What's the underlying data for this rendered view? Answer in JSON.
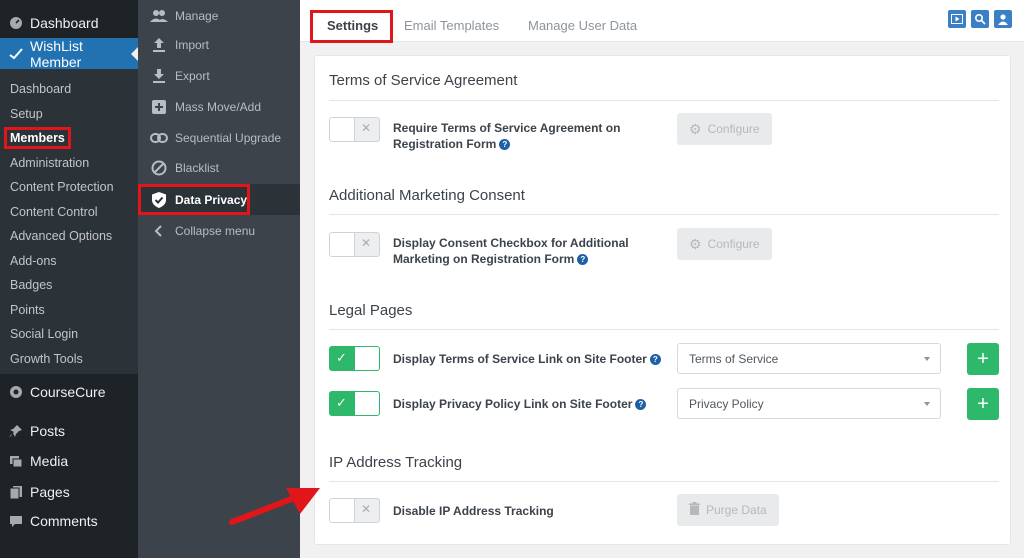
{
  "wp_sidebar": {
    "dashboard": "Dashboard",
    "wishlist": "WishList Member",
    "submenu": [
      "Dashboard",
      "Setup",
      "Members",
      "Administration",
      "Content Protection",
      "Content Control",
      "Advanced Options",
      "Add-ons",
      "Badges",
      "Points",
      "Social Login",
      "Growth Tools"
    ],
    "coursecure": "CourseCure",
    "posts": "Posts",
    "media": "Media",
    "pages": "Pages",
    "comments": "Comments"
  },
  "wlm_menu": {
    "manage": "Manage",
    "import": "Import",
    "export": "Export",
    "mass_move": "Mass Move/Add",
    "sequential": "Sequential Upgrade",
    "blacklist": "Blacklist",
    "data_privacy": "Data Privacy",
    "collapse": "Collapse menu"
  },
  "tabs": {
    "settings": "Settings",
    "email_templates": "Email Templates",
    "manage_user_data": "Manage User Data"
  },
  "sections": {
    "tos": {
      "title": "Terms of Service Agreement",
      "label_line1": "Require Terms of Service Agreement on",
      "label_line2": "Registration Form",
      "button": "Configure"
    },
    "marketing": {
      "title": "Additional Marketing Consent",
      "label_line1": "Display Consent Checkbox for Additional",
      "label_line2": "Marketing on Registration Form",
      "button": "Configure"
    },
    "legal": {
      "title": "Legal Pages",
      "tos_label": "Display Terms of Service Link on Site Footer",
      "tos_select": "Terms of Service",
      "pp_label": "Display Privacy Policy Link on Site Footer",
      "pp_select": "Privacy Policy"
    },
    "ip": {
      "title": "IP Address Tracking",
      "label": "Disable IP Address Tracking",
      "button": "Purge Data"
    }
  },
  "colors": {
    "highlight": "#e0161b",
    "toggle_on": "#2eb86b",
    "wp_blue": "#2271b1"
  }
}
